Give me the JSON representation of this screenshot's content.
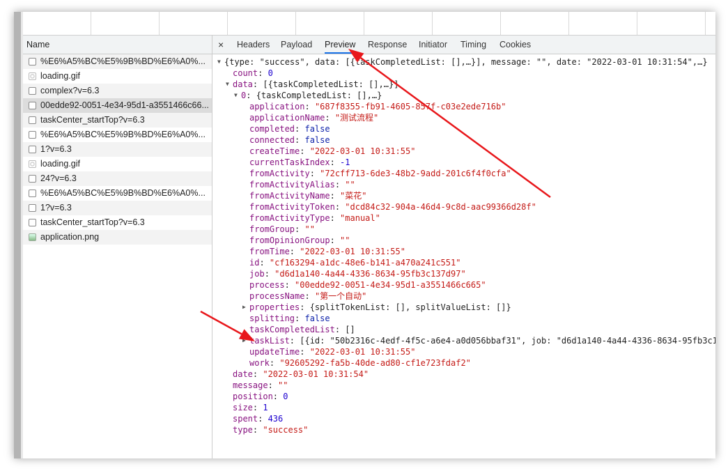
{
  "names_panel": {
    "header": "Name",
    "rows": [
      {
        "name": "%E6%A5%BC%E5%9B%BD%E6%A0%...",
        "icon": "document-icon"
      },
      {
        "name": "loading.gif",
        "icon": "gif-icon"
      },
      {
        "name": "complex?v=6.3",
        "icon": "document-icon"
      },
      {
        "name": "00edde92-0051-4e34-95d1-a3551466c66...",
        "icon": "document-icon",
        "selected": true
      },
      {
        "name": "taskCenter_startTop?v=6.3",
        "icon": "document-icon"
      },
      {
        "name": "%E6%A5%BC%E5%9B%BD%E6%A0%...",
        "icon": "document-icon"
      },
      {
        "name": "1?v=6.3",
        "icon": "document-icon"
      },
      {
        "name": "loading.gif",
        "icon": "gif-icon"
      },
      {
        "name": "24?v=6.3",
        "icon": "document-icon"
      },
      {
        "name": "%E6%A5%BC%E5%9B%BD%E6%A0%...",
        "icon": "document-icon"
      },
      {
        "name": "1?v=6.3",
        "icon": "document-icon"
      },
      {
        "name": "taskCenter_startTop?v=6.3",
        "icon": "document-icon"
      },
      {
        "name": "application.png",
        "icon": "image-icon"
      }
    ]
  },
  "tabs": {
    "close": "×",
    "items": [
      "Headers",
      "Payload",
      "Preview",
      "Response",
      "Initiator",
      "Timing",
      "Cookies"
    ],
    "active": "Preview"
  },
  "preview": [
    {
      "level": 0,
      "toggle": "open",
      "key": "",
      "value": "{type: \"success\", data: [{taskCompletedList: [],…}], message: \"\", date: \"2022-03-01 10:31:54\",…}",
      "t": "p"
    },
    {
      "level": 1,
      "key": "count",
      "value": "0",
      "t": "n"
    },
    {
      "level": 1,
      "toggle": "open",
      "key": "data",
      "value": "[{taskCompletedList: [],…}]",
      "t": "p"
    },
    {
      "level": 2,
      "toggle": "open",
      "key": "0",
      "value": "{taskCompletedList: [],…}",
      "t": "p"
    },
    {
      "level": 3,
      "key": "application",
      "value": "\"687f8355-fb91-4605-857f-c03e2ede716b\"",
      "t": "s"
    },
    {
      "level": 3,
      "key": "applicationName",
      "value": "\"测试流程\"",
      "t": "s"
    },
    {
      "level": 3,
      "key": "completed",
      "value": "false",
      "t": "b"
    },
    {
      "level": 3,
      "key": "connected",
      "value": "false",
      "t": "b"
    },
    {
      "level": 3,
      "key": "createTime",
      "value": "\"2022-03-01 10:31:55\"",
      "t": "s"
    },
    {
      "level": 3,
      "key": "currentTaskIndex",
      "value": "-1",
      "t": "n"
    },
    {
      "level": 3,
      "key": "fromActivity",
      "value": "\"72cff713-6de3-48b2-9add-201c6f4f0cfa\"",
      "t": "s"
    },
    {
      "level": 3,
      "key": "fromActivityAlias",
      "value": "\"\"",
      "t": "s"
    },
    {
      "level": 3,
      "key": "fromActivityName",
      "value": "\"菜花\"",
      "t": "s"
    },
    {
      "level": 3,
      "key": "fromActivityToken",
      "value": "\"dcd84c32-904a-46d4-9c8d-aac99366d28f\"",
      "t": "s"
    },
    {
      "level": 3,
      "key": "fromActivityType",
      "value": "\"manual\"",
      "t": "s"
    },
    {
      "level": 3,
      "key": "fromGroup",
      "value": "\"\"",
      "t": "s"
    },
    {
      "level": 3,
      "key": "fromOpinionGroup",
      "value": "\"\"",
      "t": "s"
    },
    {
      "level": 3,
      "key": "fromTime",
      "value": "\"2022-03-01 10:31:55\"",
      "t": "s"
    },
    {
      "level": 3,
      "key": "id",
      "value": "\"cf163294-a1dc-48e6-b141-a470a241c551\"",
      "t": "s"
    },
    {
      "level": 3,
      "key": "job",
      "value": "\"d6d1a140-4a44-4336-8634-95fb3c137d97\"",
      "t": "s"
    },
    {
      "level": 3,
      "key": "process",
      "value": "\"00edde92-0051-4e34-95d1-a3551466c665\"",
      "t": "s"
    },
    {
      "level": 3,
      "key": "processName",
      "value": "\"第一个自动\"",
      "t": "s"
    },
    {
      "level": 3,
      "toggle": "closed",
      "key": "properties",
      "value": "{splitTokenList: [], splitValueList: []}",
      "t": "p"
    },
    {
      "level": 3,
      "key": "splitting",
      "value": "false",
      "t": "b"
    },
    {
      "level": 3,
      "key": "taskCompletedList",
      "value": "[]",
      "t": "p"
    },
    {
      "level": 3,
      "toggle": "closed",
      "key": "taskList",
      "value": "[{id: \"50b2316c-4edf-4f5c-a6e4-a0d056bbaf31\", job: \"d6d1a140-4a44-4336-8634-95fb3c1",
      "t": "p"
    },
    {
      "level": 3,
      "key": "updateTime",
      "value": "\"2022-03-01 10:31:55\"",
      "t": "s"
    },
    {
      "level": 3,
      "key": "work",
      "value": "\"92605292-fa5b-40de-ad80-cf1e723fdaf2\"",
      "t": "s"
    },
    {
      "level": 1,
      "key": "date",
      "value": "\"2022-03-01 10:31:54\"",
      "t": "s"
    },
    {
      "level": 1,
      "key": "message",
      "value": "\"\"",
      "t": "s"
    },
    {
      "level": 1,
      "key": "position",
      "value": "0",
      "t": "n"
    },
    {
      "level": 1,
      "key": "size",
      "value": "1",
      "t": "n"
    },
    {
      "level": 1,
      "key": "spent",
      "value": "436",
      "t": "n"
    },
    {
      "level": 1,
      "key": "type",
      "value": "\"success\"",
      "t": "s"
    }
  ],
  "annotation_color": "#e8171b"
}
